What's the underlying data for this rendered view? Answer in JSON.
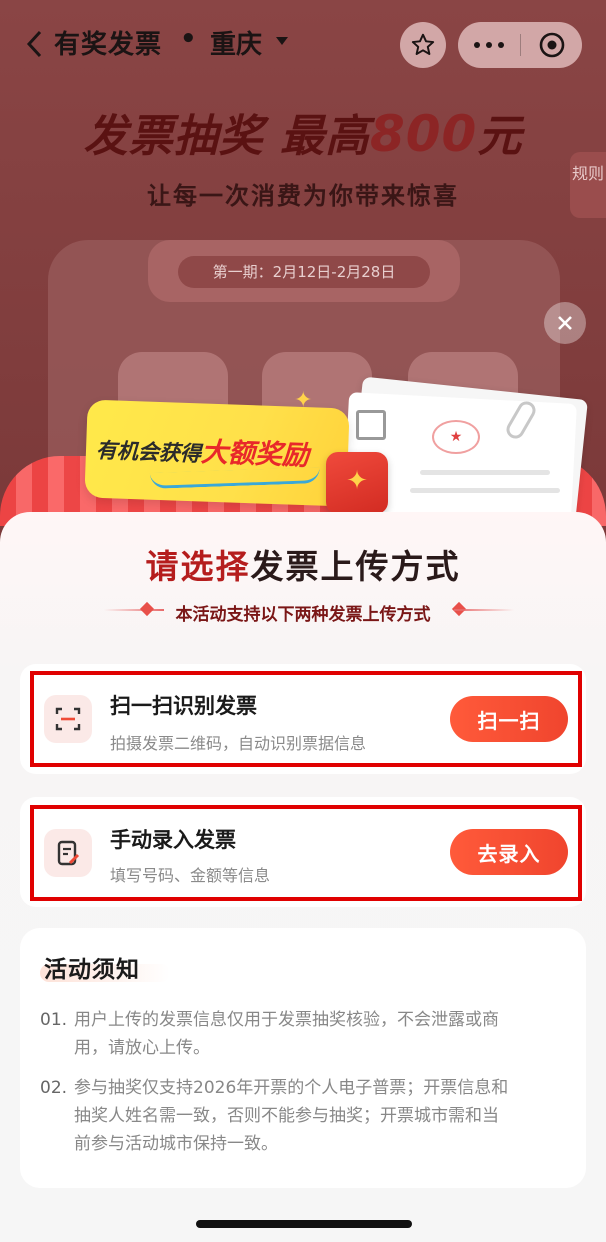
{
  "nav": {
    "title": "有奖发票",
    "separator": "•",
    "city": "重庆"
  },
  "hero": {
    "headline_prefix": "发票抽奖 最高",
    "headline_amount": "800",
    "headline_suffix": "元",
    "subtitle": "让每一次消费为你带来惊喜",
    "rules_tab": "规则",
    "period": "第一期：2月12日-2月28日",
    "promo_prefix": "有机会获得",
    "promo_highlight": "大额奖励"
  },
  "sheet": {
    "title_highlight": "请选择",
    "title_rest": "发票上传方式",
    "subtitle": "本活动支持以下两种发票上传方式",
    "options": [
      {
        "title": "扫一扫识别发票",
        "desc": "拍摄发票二维码，自动识别票据信息",
        "action": "扫一扫",
        "icon": "scan-icon"
      },
      {
        "title": "手动录入发票",
        "desc": "填写号码、金额等信息",
        "action": "去录入",
        "icon": "edit-document-icon"
      }
    ]
  },
  "notice": {
    "title": "活动须知",
    "items": [
      {
        "num": "01.",
        "line1": "用户上传的发票信息仅用于发票抽奖核验，不会泄露或商",
        "line2": "用，请放心上传。"
      },
      {
        "num": "02.",
        "line1": "参与抽奖仅支持2026年开票的个人电子普票；开票信息和",
        "line2": "抽奖人姓名需一致，否则不能参与抽奖；开票城市需和当",
        "line3": "前参与活动城市保持一致。"
      }
    ]
  },
  "colors": {
    "accent": "#f0452e",
    "highlight_border": "#e00000",
    "title_red": "#b51d1d"
  }
}
